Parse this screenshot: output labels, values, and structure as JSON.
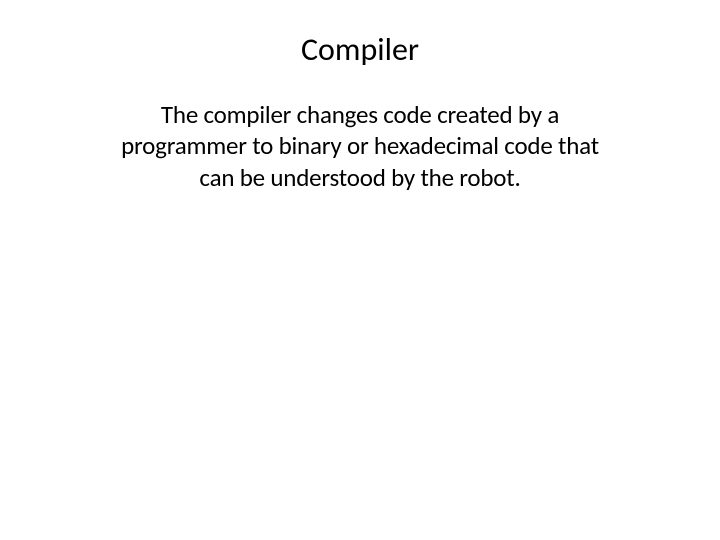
{
  "slide": {
    "title": "Compiler",
    "body": "The compiler changes code created by a programmer to binary or hexadecimal code that can be understood by the robot."
  }
}
